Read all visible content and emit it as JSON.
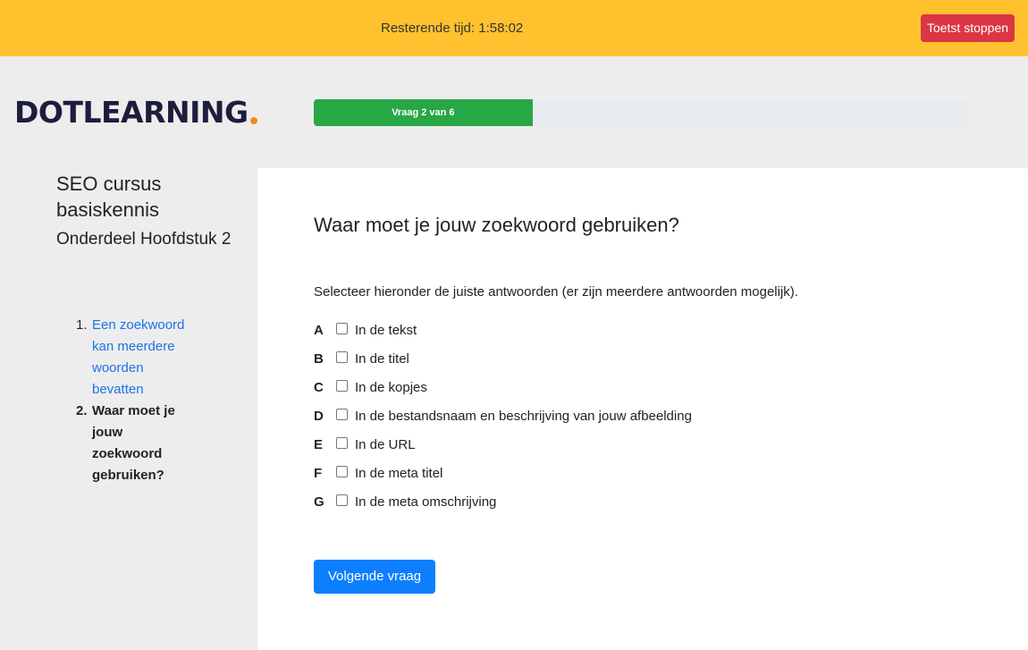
{
  "topbar": {
    "timer_text": "Resterende tijd: 1:58:02",
    "stop_label": "Toetst stoppen"
  },
  "brand": {
    "logo_text": "DOTLEARNING"
  },
  "progress": {
    "label": "Vraag 2 van 6",
    "fraction": 0.333,
    "color": "#28a745"
  },
  "sidebar": {
    "course_title": "SEO cursus basiskennis",
    "section_title": "Onderdeel Hoofdstuk 2",
    "items": [
      {
        "num": "1.",
        "label": "Een zoekwoord kan meerdere woorden bevatten"
      },
      {
        "num": "2.",
        "label": "Waar moet je jouw zoekwoord gebruiken?"
      }
    ]
  },
  "main": {
    "question": "Waar moet je jouw zoekwoord gebruiken?",
    "instructions": "Selecteer hieronder de juiste antwoorden (er zijn meerdere antwoorden mogelijk).",
    "options": [
      {
        "letter": "A",
        "label": "In de tekst"
      },
      {
        "letter": "B",
        "label": "In de titel"
      },
      {
        "letter": "C",
        "label": "In de kopjes"
      },
      {
        "letter": "D",
        "label": "In de bestandsnaam en beschrijving van jouw afbeelding"
      },
      {
        "letter": "E",
        "label": "In de URL"
      },
      {
        "letter": "F",
        "label": "In de meta titel"
      },
      {
        "letter": "G",
        "label": "In de meta omschrijving"
      }
    ],
    "next_label": "Volgende vraag"
  },
  "colors": {
    "topbar": "#ffc22e",
    "stop_button": "#dc3545",
    "primary": "#0d7efd",
    "link": "#1a73e8",
    "logo_dot": "#f18a1d"
  }
}
